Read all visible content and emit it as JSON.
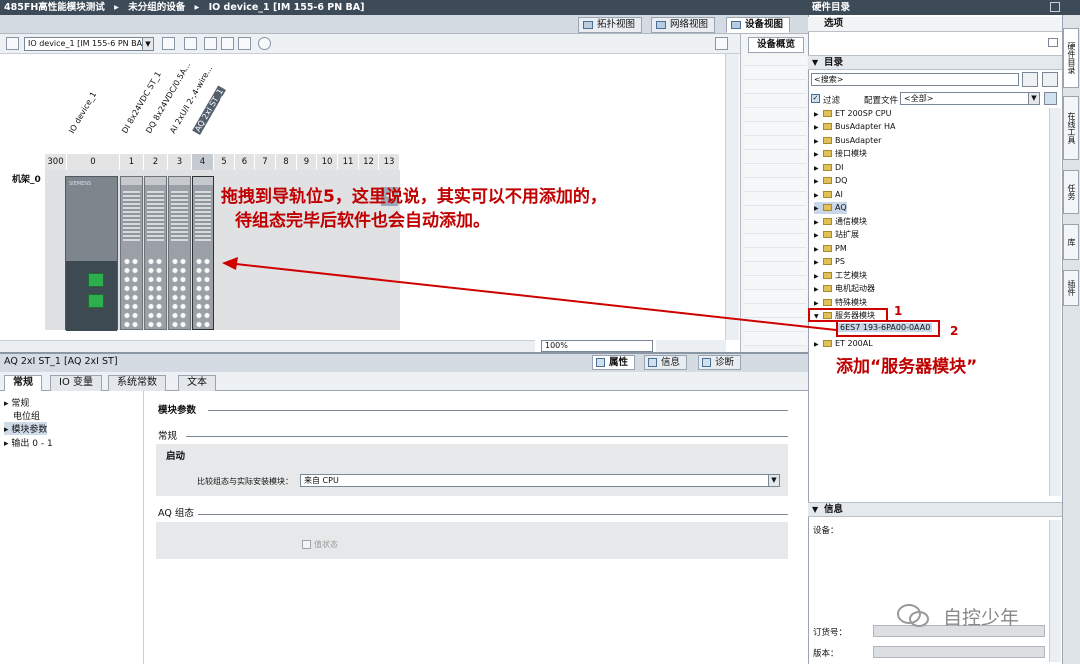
{
  "title": {
    "parts": [
      "485FH高性能模块测试",
      "▸",
      "未分组的设备",
      "▸",
      "IO device_1 [IM 155-6 PN BA]"
    ]
  },
  "hw_catalog": {
    "header": "硬件目录",
    "options_label": "选项",
    "catalog_label": "目录",
    "search_placeholder": "<搜索>",
    "filter_label": "过滤",
    "profile_label": "配置文件",
    "profile_value": "<全部>",
    "items": [
      "ET 200SP CPU",
      "BusAdapter HA",
      "BusAdapter",
      "接口模块",
      "DI",
      "DQ",
      "AI",
      "AQ",
      "通信模块",
      "站扩展",
      "PM",
      "PS",
      "工艺模块",
      "电机起动器",
      "特殊模块",
      "服务器模块"
    ],
    "service_module_item": "6ES7 193-6PA00-0AA0",
    "next_item": "ET 200AL",
    "info_label": "信息",
    "device_label": "设备：",
    "order_no_label": "订货号：",
    "version_label": "版本："
  },
  "vertical_tabs": [
    "硬件目录",
    "在线工具",
    "任务",
    "库",
    "插件"
  ],
  "view_tabs": {
    "topology": "拓扑视图",
    "network": "网络视图",
    "device": "设备视图"
  },
  "toolbar": {
    "device_select": "IO device_1 [IM 155-6 PN BA]"
  },
  "overview_tab": "设备概览",
  "canvas": {
    "module_labels": [
      "IO device_1",
      "DI 8x24VDC ST_1",
      "DQ 8x24VDC/0.5A...",
      "AI 2xU/I 2-,4-wire...",
      "AQ 2xI ST_1"
    ],
    "slots": [
      "300",
      "0",
      "1",
      "2",
      "3",
      "4",
      "5",
      "6",
      "7",
      "8",
      "9",
      "10",
      "11",
      "12",
      "13"
    ],
    "rack_label": "机架_0",
    "collapse_arrow": "◀",
    "brand": "SIEMENS"
  },
  "zoom": "100%",
  "annotations": {
    "drag_line1": "拖拽到导轨位5，这里说说，其实可以不用添加的，",
    "drag_line2": "待组态完毕后软件也会自动添加。",
    "num1": "1",
    "num2": "2",
    "add_service": "添加“服务器模块”"
  },
  "properties": {
    "title": "AQ 2xI ST_1 [AQ 2xI ST]",
    "tab_props": "属性",
    "tab_info": "信息",
    "tab_diag": "诊断",
    "inspector_tabs": [
      "常规",
      "IO 变量",
      "系统常数",
      "文本"
    ],
    "nav": [
      "常规",
      "电位组",
      "模块参数",
      "输出 0 - 1"
    ],
    "module_params": "模块参数",
    "general": "常规",
    "startup": "启动",
    "compare_label": "比较组态与实际安装模块：",
    "compare_value": "来自 CPU",
    "aq_config": "AQ 组态",
    "value_status": "值状态"
  },
  "watermark": "自控少年"
}
